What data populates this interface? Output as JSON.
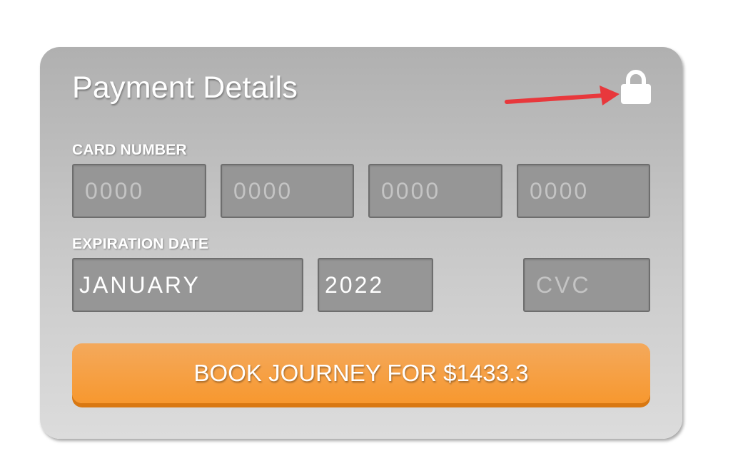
{
  "payment": {
    "title": "Payment Details",
    "card_number_label": "CARD NUMBER",
    "card_number_placeholders": [
      "0000",
      "0000",
      "0000",
      "0000"
    ],
    "expiration_label": "EXPIRATION DATE",
    "expiration_month": "JANUARY",
    "expiration_year": "2022",
    "cvc_placeholder": "CVC",
    "book_button_label": "BOOK JOURNEY FOR $1433.3"
  },
  "icons": {
    "lock": "lock-icon",
    "annotation_arrow": "arrow-icon"
  },
  "colors": {
    "accent": "#f7982f",
    "annotation_arrow": "#e8383c"
  }
}
